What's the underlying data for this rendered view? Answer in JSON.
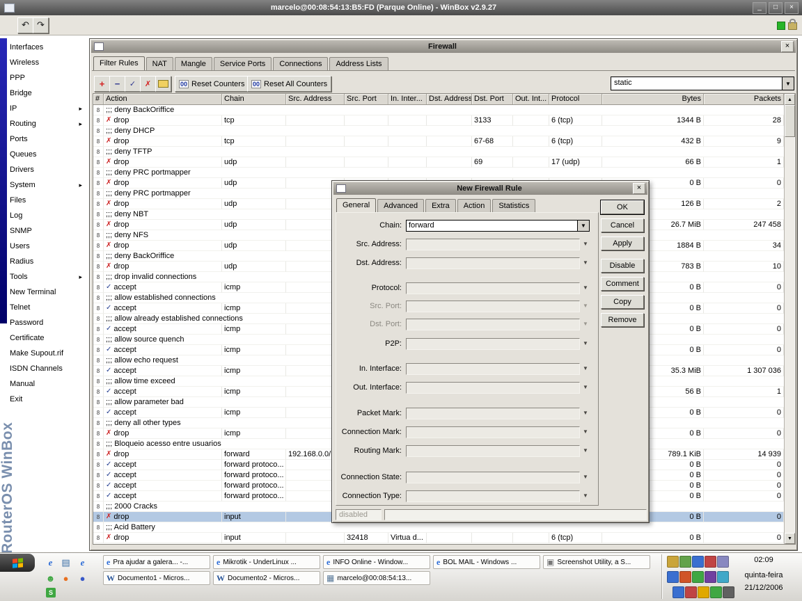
{
  "main_window": {
    "title": "marcelo@00:08:54:13:B5:FD (Parque Online) - WinBox v2.9.27"
  },
  "icons": {
    "undo": "↶",
    "redo": "↷",
    "minimize": "_",
    "restore": "□",
    "close": "×",
    "dropdown_arrow": "▼",
    "scroll_up": "▲",
    "scroll_down": "▼",
    "submenu_arrow": "▸",
    "add": "+",
    "remove": "−",
    "enable": "✓",
    "disable": "✗",
    "row_flag": "8"
  },
  "sidebar": {
    "brand": "RouterOS WinBox",
    "items": [
      {
        "label": "Interfaces",
        "submenu": false
      },
      {
        "label": "Wireless",
        "submenu": false
      },
      {
        "label": "PPP",
        "submenu": false
      },
      {
        "label": "Bridge",
        "submenu": false
      },
      {
        "label": "IP",
        "submenu": true
      },
      {
        "label": "Routing",
        "submenu": true
      },
      {
        "label": "Ports",
        "submenu": false
      },
      {
        "label": "Queues",
        "submenu": false
      },
      {
        "label": "Drivers",
        "submenu": false
      },
      {
        "label": "System",
        "submenu": true
      },
      {
        "label": "Files",
        "submenu": false
      },
      {
        "label": "Log",
        "submenu": false
      },
      {
        "label": "SNMP",
        "submenu": false
      },
      {
        "label": "Users",
        "submenu": false
      },
      {
        "label": "Radius",
        "submenu": false
      },
      {
        "label": "Tools",
        "submenu": true
      },
      {
        "label": "New Terminal",
        "submenu": false
      },
      {
        "label": "Telnet",
        "submenu": false
      },
      {
        "label": "Password",
        "submenu": false
      },
      {
        "label": "Certificate",
        "submenu": false
      },
      {
        "label": "Make Supout.rif",
        "submenu": false
      },
      {
        "label": "ISDN Channels",
        "submenu": false
      },
      {
        "label": "Manual",
        "submenu": false
      },
      {
        "label": "Exit",
        "submenu": false
      }
    ]
  },
  "firewall": {
    "title": "Firewall",
    "tabs": [
      {
        "label": "Filter Rules",
        "active": true
      },
      {
        "label": "NAT"
      },
      {
        "label": "Mangle"
      },
      {
        "label": "Service Ports"
      },
      {
        "label": "Connections"
      },
      {
        "label": "Address Lists"
      }
    ],
    "toolbar": {
      "counter_prefix": "00",
      "reset_counters": "Reset Counters",
      "reset_all_counters": "Reset All Counters",
      "filter_value": "static"
    },
    "columns": [
      {
        "label": "#",
        "width": 15
      },
      {
        "label": "Action",
        "width": 170
      },
      {
        "label": "Chain",
        "width": 92
      },
      {
        "label": "Src. Address",
        "width": 84
      },
      {
        "label": "Src. Port",
        "width": 63
      },
      {
        "label": "In. Inter...",
        "width": 55
      },
      {
        "label": "Dst. Address",
        "width": 65
      },
      {
        "label": "Dst. Port",
        "width": 59
      },
      {
        "label": "Out. Int...",
        "width": 52
      },
      {
        "label": "Protocol",
        "width": 76
      },
      {
        "label": "Bytes",
        "width": 146
      },
      {
        "label": "Packets",
        "width": 115
      }
    ],
    "rows": [
      {
        "type": "comment",
        "text": ";;; deny BackOriffice"
      },
      {
        "type": "rule",
        "action": "drop",
        "chain": "tcp",
        "dst_port": "3133",
        "protocol": "6 (tcp)",
        "bytes": "1344 B",
        "packets": "28"
      },
      {
        "type": "comment",
        "text": ";;; deny DHCP"
      },
      {
        "type": "rule",
        "action": "drop",
        "chain": "tcp",
        "dst_port": "67-68",
        "protocol": "6 (tcp)",
        "bytes": "432 B",
        "packets": "9"
      },
      {
        "type": "comment",
        "text": ";;; deny TFTP"
      },
      {
        "type": "rule",
        "action": "drop",
        "chain": "udp",
        "dst_port": "69",
        "protocol": "17 (udp)",
        "bytes": "66 B",
        "packets": "1"
      },
      {
        "type": "comment",
        "text": ";;; deny PRC portmapper"
      },
      {
        "type": "rule",
        "action": "drop",
        "chain": "udp",
        "bytes": "0 B",
        "packets": "0"
      },
      {
        "type": "comment",
        "text": ";;; deny PRC portmapper"
      },
      {
        "type": "rule",
        "action": "drop",
        "chain": "udp",
        "bytes": "126 B",
        "packets": "2"
      },
      {
        "type": "comment",
        "text": ";;; deny NBT"
      },
      {
        "type": "rule",
        "action": "drop",
        "chain": "udp",
        "bytes": "26.7 MiB",
        "packets": "247 458"
      },
      {
        "type": "comment",
        "text": ";;; deny NFS"
      },
      {
        "type": "rule",
        "action": "drop",
        "chain": "udp",
        "bytes": "1884 B",
        "packets": "34"
      },
      {
        "type": "comment",
        "text": ";;; deny BackOriffice"
      },
      {
        "type": "rule",
        "action": "drop",
        "chain": "udp",
        "bytes": "783 B",
        "packets": "10"
      },
      {
        "type": "comment",
        "text": ";;; drop invalid connections"
      },
      {
        "type": "rule",
        "action": "accept",
        "chain": "icmp",
        "bytes": "0 B",
        "packets": "0"
      },
      {
        "type": "comment",
        "text": ";;; allow established connections"
      },
      {
        "type": "rule",
        "action": "accept",
        "chain": "icmp",
        "bytes": "0 B",
        "packets": "0"
      },
      {
        "type": "comment",
        "text": ";;; allow already established connections"
      },
      {
        "type": "rule",
        "action": "accept",
        "chain": "icmp",
        "bytes": "0 B",
        "packets": "0"
      },
      {
        "type": "comment",
        "text": ";;; allow source quench"
      },
      {
        "type": "rule",
        "action": "accept",
        "chain": "icmp",
        "bytes": "0 B",
        "packets": "0"
      },
      {
        "type": "comment",
        "text": ";;; allow echo request"
      },
      {
        "type": "rule",
        "action": "accept",
        "chain": "icmp",
        "bytes": "35.3 MiB",
        "packets": "1 307 036"
      },
      {
        "type": "comment",
        "text": ";;; allow time exceed"
      },
      {
        "type": "rule",
        "action": "accept",
        "chain": "icmp",
        "bytes": "56 B",
        "packets": "1"
      },
      {
        "type": "comment",
        "text": ";;; allow parameter bad"
      },
      {
        "type": "rule",
        "action": "accept",
        "chain": "icmp",
        "bytes": "0 B",
        "packets": "0"
      },
      {
        "type": "comment",
        "text": ";;; deny all other types"
      },
      {
        "type": "rule",
        "action": "drop",
        "chain": "icmp",
        "bytes": "0 B",
        "packets": "0"
      },
      {
        "type": "comment",
        "text": ";;; Bloqueio acesso entre usuarios"
      },
      {
        "type": "rule",
        "action": "drop",
        "chain": "forward",
        "src_address": "192.168.0.0/...",
        "bytes": "789.1 KiB",
        "packets": "14 939"
      },
      {
        "type": "rule",
        "action": "accept",
        "chain": "forward protoco...",
        "bytes": "0 B",
        "packets": "0"
      },
      {
        "type": "rule",
        "action": "accept",
        "chain": "forward protoco...",
        "bytes": "0 B",
        "packets": "0"
      },
      {
        "type": "rule",
        "action": "accept",
        "chain": "forward protoco...",
        "bytes": "0 B",
        "packets": "0"
      },
      {
        "type": "rule",
        "action": "accept",
        "chain": "forward protoco...",
        "bytes": "0 B",
        "packets": "0"
      },
      {
        "type": "comment",
        "text": ";;; 2000 Cracks"
      },
      {
        "type": "rule",
        "action": "drop",
        "chain": "input",
        "bytes": "0 B",
        "packets": "0",
        "selected": true
      },
      {
        "type": "comment",
        "text": ";;; Acid Battery"
      },
      {
        "type": "rule",
        "action": "drop",
        "chain": "input",
        "src_port": "32418",
        "in_interface": "Virtua d...",
        "protocol": "6 (tcp)",
        "bytes": "0 B",
        "packets": "0"
      }
    ]
  },
  "dialog": {
    "title": "New Firewall Rule",
    "tabs": [
      {
        "label": "General",
        "active": true
      },
      {
        "label": "Advanced"
      },
      {
        "label": "Extra"
      },
      {
        "label": "Action"
      },
      {
        "label": "Statistics"
      }
    ],
    "fields": [
      {
        "label": "Chain:",
        "value": "forward",
        "type": "combo"
      },
      {
        "label": "Src. Address:",
        "value": ""
      },
      {
        "label": "Dst. Address:",
        "value": ""
      },
      {
        "label": "Protocol:",
        "value": ""
      },
      {
        "label": "Src. Port:",
        "value": "",
        "disabled": true
      },
      {
        "label": "Dst. Port:",
        "value": "",
        "disabled": true
      },
      {
        "label": "P2P:",
        "value": ""
      },
      {
        "label": "In. Interface:",
        "value": ""
      },
      {
        "label": "Out. Interface:",
        "value": ""
      },
      {
        "label": "Packet Mark:",
        "value": ""
      },
      {
        "label": "Connection Mark:",
        "value": ""
      },
      {
        "label": "Routing Mark:",
        "value": ""
      },
      {
        "label": "Connection State:",
        "value": ""
      },
      {
        "label": "Connection Type:",
        "value": ""
      }
    ],
    "buttons": [
      {
        "label": "OK",
        "default": true
      },
      {
        "label": "Cancel"
      },
      {
        "label": "Apply"
      },
      {
        "label": "Disable"
      },
      {
        "label": "Comment"
      },
      {
        "label": "Copy"
      },
      {
        "label": "Remove"
      }
    ],
    "status": "disabled"
  },
  "taskbar": {
    "quicklaunch": [
      {
        "name": "ie-icon",
        "glyph": "e",
        "fg": "#2b6bd6"
      },
      {
        "name": "show-desktop-icon",
        "glyph": "▤",
        "fg": "#3a6ea5"
      },
      {
        "name": "ie-shortcut-icon",
        "glyph": "e",
        "fg": "#2b6bd6"
      },
      {
        "name": "messenger-icon",
        "glyph": "☻",
        "fg": "#3fa742"
      },
      {
        "name": "firefox-icon",
        "glyph": "●",
        "fg": "#e87020"
      },
      {
        "name": "media-player-icon",
        "glyph": "●",
        "fg": "#3858c8"
      }
    ],
    "tasks_row1": [
      {
        "label": "Pra ajudar a galera... -...",
        "icon": "ie-icon",
        "glyph": "e",
        "fg": "#2b6bd6"
      },
      {
        "label": "Mikrotik - UnderLinux ...",
        "icon": "ie-icon",
        "glyph": "e",
        "fg": "#2b6bd6"
      },
      {
        "label": "INFO Online - Window...",
        "icon": "ie-icon",
        "glyph": "e",
        "fg": "#2b6bd6"
      },
      {
        "label": "BOL MAIL - Windows ...",
        "icon": "ie-icon",
        "glyph": "e",
        "fg": "#2b6bd6"
      },
      {
        "label": "Screenshot Utility, a S...",
        "icon": "screenshot-utility-icon",
        "glyph": "▣",
        "fg": "#777777"
      }
    ],
    "tasks_row2": [
      {
        "label": "Documento1 - Micros...",
        "icon": "word-icon",
        "glyph": "W",
        "fg": "#2b579a"
      },
      {
        "label": "Documento2 - Micros...",
        "icon": "word-icon",
        "glyph": "W",
        "fg": "#2b579a"
      },
      {
        "label": "marcelo@00:08:54:13...",
        "icon": "winbox-task-icon",
        "glyph": "▦",
        "fg": "#5a7a9a"
      }
    ],
    "tray_row1": [
      {
        "color": "#caa53a"
      },
      {
        "color": "#63a24a"
      },
      {
        "color": "#3a6fd0"
      },
      {
        "color": "#c04444"
      },
      {
        "color": "#8888c0"
      }
    ],
    "tray_row2": [
      {
        "color": "#3a6fd0"
      },
      {
        "color": "#d05428"
      },
      {
        "color": "#3fa742"
      },
      {
        "color": "#7040a0"
      },
      {
        "color": "#40a8c8"
      }
    ],
    "tray_row3": [
      {
        "color": "#3a6fd0"
      },
      {
        "color": "#c04444"
      },
      {
        "color": "#e0a800"
      },
      {
        "color": "#3fa742"
      },
      {
        "color": "#606060"
      }
    ],
    "corner_icon": {
      "glyph": "S"
    },
    "clock": {
      "time": "02:09",
      "weekday": "quinta-feira",
      "date": "21/12/2006"
    }
  }
}
